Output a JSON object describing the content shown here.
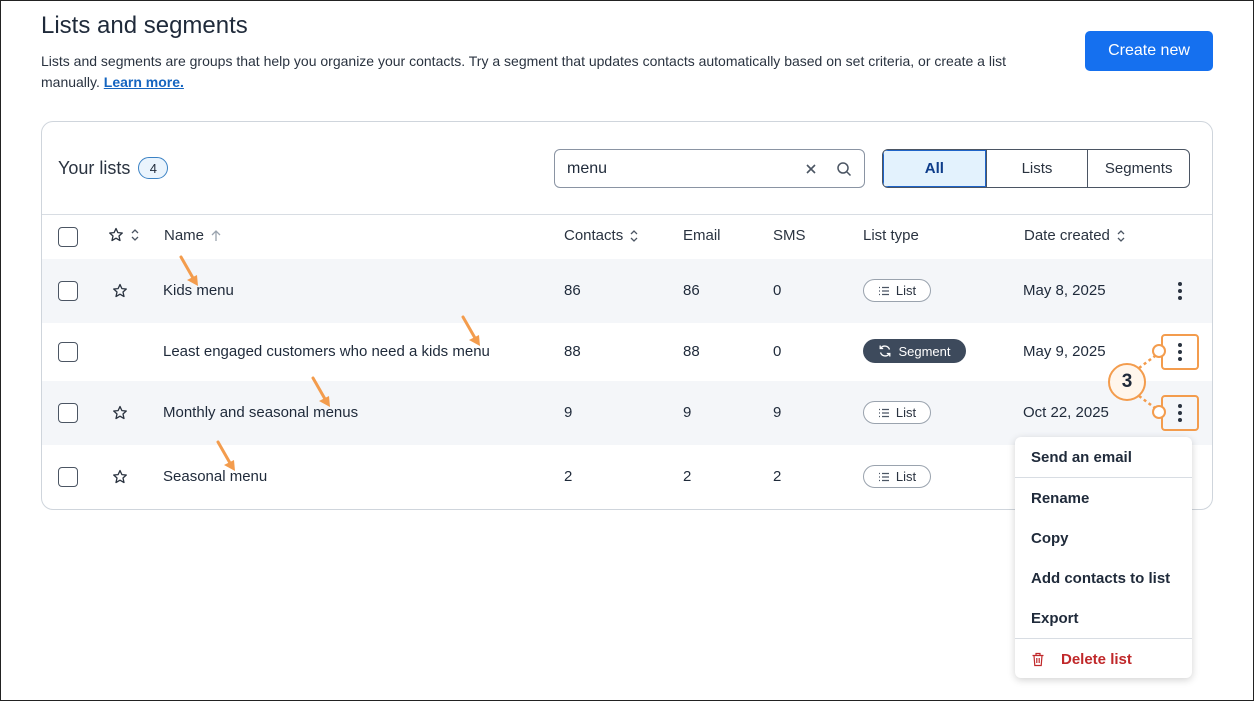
{
  "header": {
    "title": "Lists and segments",
    "description": "Lists and segments are groups that help you organize your contacts. Try a segment that updates contacts automatically based on set criteria, or create a list manually.",
    "learn_more": "Learn more.",
    "create_button": "Create new"
  },
  "toolbar": {
    "your_lists_label": "Your lists",
    "count": "4",
    "search_value": "menu",
    "filters": [
      "All",
      "Lists",
      "Segments"
    ],
    "active_filter": "All"
  },
  "table": {
    "columns": [
      "Name",
      "Contacts",
      "Email",
      "SMS",
      "List type",
      "Date created"
    ],
    "rows": [
      {
        "name": "Kids menu",
        "contacts": "86",
        "email": "86",
        "sms": "0",
        "type": "List",
        "date": "May 8, 2025"
      },
      {
        "name": "Least engaged customers who need a kids menu",
        "contacts": "88",
        "email": "88",
        "sms": "0",
        "type": "Segment",
        "date": "May 9, 2025"
      },
      {
        "name": "Monthly and seasonal menus",
        "contacts": "9",
        "email": "9",
        "sms": "9",
        "type": "List",
        "date": "Oct 22, 2025"
      },
      {
        "name": "Seasonal menu",
        "contacts": "2",
        "email": "2",
        "sms": "2",
        "type": "List",
        "date": ""
      }
    ]
  },
  "context_menu": {
    "items": [
      "Send an email",
      "Rename",
      "Copy",
      "Add contacts to list",
      "Export"
    ],
    "delete": "Delete list"
  },
  "callout": {
    "number": "3"
  },
  "colors": {
    "accent": "#1570ef",
    "highlight": "#f39c4d",
    "danger": "#c0282a",
    "segment_pill": "#3d4a5c"
  }
}
